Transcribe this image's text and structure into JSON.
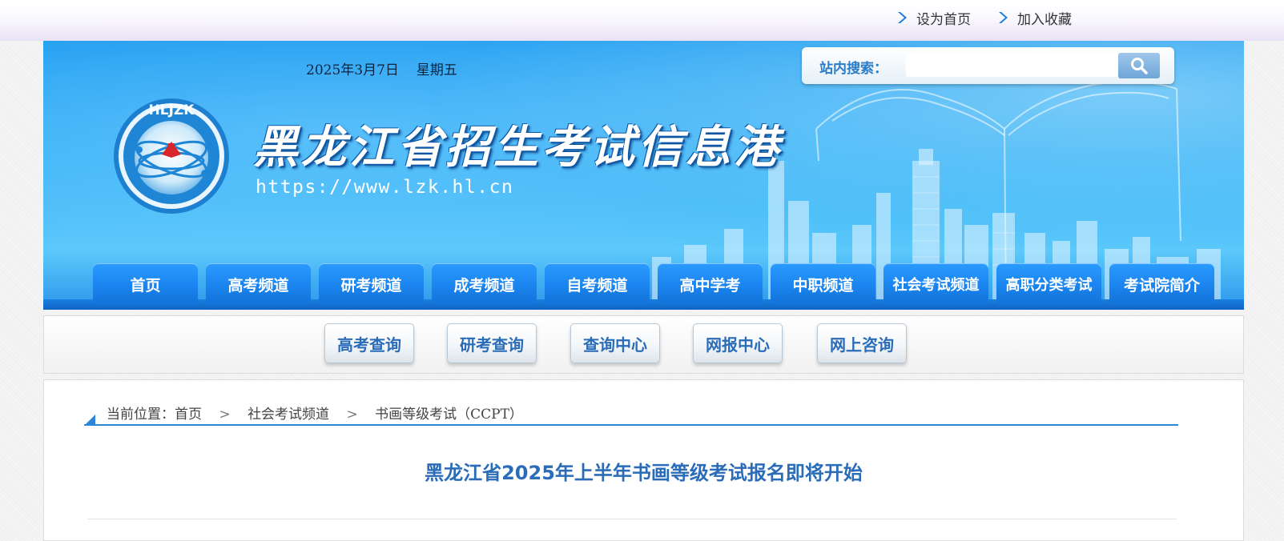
{
  "top_links": [
    "设为首页",
    "加入收藏"
  ],
  "header": {
    "date": "2025年3月7日",
    "weekday": "星期五",
    "logo_text": "HLJZK",
    "site_title": "黑龙江省招生考试信息港",
    "site_url": "https://www.lzk.hl.cn"
  },
  "search": {
    "label": "站内搜索：",
    "value": "",
    "placeholder": ""
  },
  "nav": [
    "首页",
    "高考频道",
    "研考频道",
    "成考频道",
    "自考频道",
    "高中学考",
    "中职频道",
    "社会考试频道",
    "高职分类考试",
    "考试院简介"
  ],
  "quick_links": [
    "高考查询",
    "研考查询",
    "查询中心",
    "网报中心",
    "网上咨询"
  ],
  "breadcrumb": {
    "prefix": "当前位置：",
    "items": [
      "首页",
      "社会考试频道",
      "书画等级考试（CCPT）"
    ],
    "separator": ">"
  },
  "article": {
    "title": "黑龙江省2025年上半年书画等级考试报名即将开始"
  },
  "colors": {
    "nav_blue": "#1a84ee",
    "link_blue": "#2a6cb7",
    "banner_blue": "#2aa6f3"
  }
}
